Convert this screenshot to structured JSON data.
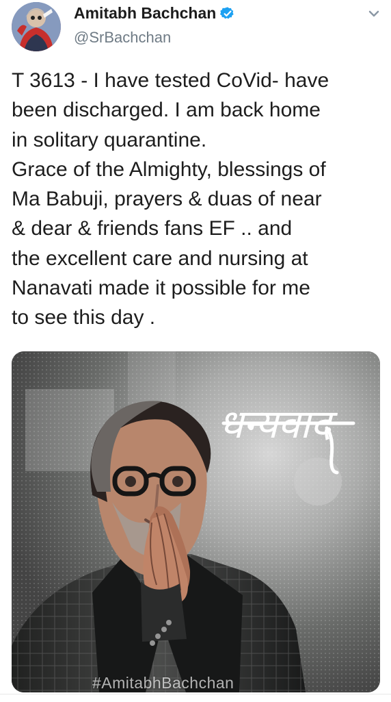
{
  "author": {
    "name": "Amitabh Bachchan",
    "handle": "@SrBachchan",
    "verified_icon": "verified-badge-icon",
    "accent": "#1da1f2"
  },
  "tweet": {
    "lines": [
      "T 3613 - I have tested CoVid- have",
      "been discharged. I am back home",
      "in solitary quarantine.",
      "Grace of the Almighty, blessings of",
      "Ma Babuji, prayers & duas of near",
      "& dear & friends fans EF .. and",
      "the excellent care and nursing at",
      "Nanavati made it possible for me",
      "to see this day ."
    ]
  },
  "media": {
    "devanagari_text": "धन्यवाद",
    "hashtag": "#AmitabhBachchan"
  },
  "icons": {
    "avatar": "profile-avatar",
    "more": "chevron-down-icon"
  }
}
